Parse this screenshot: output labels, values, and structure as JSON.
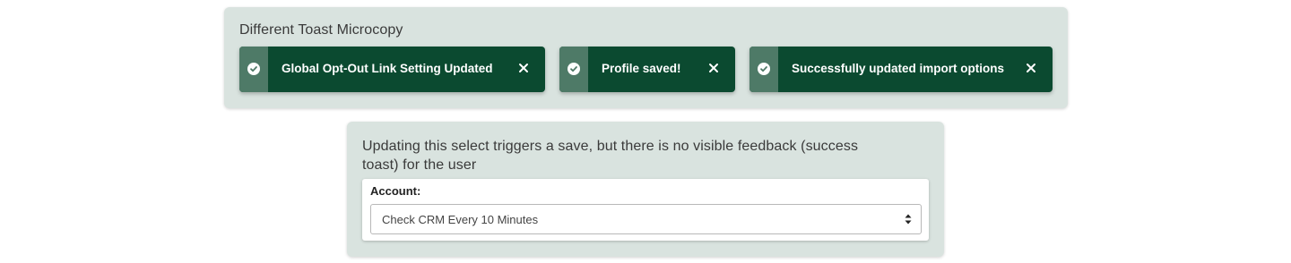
{
  "toast_panel": {
    "title": "Different Toast Microcopy",
    "toasts": [
      {
        "message": "Global Opt-Out Link Setting Updated",
        "icon": "check-circle-icon",
        "close_icon": "close-icon"
      },
      {
        "message": "Profile saved!",
        "icon": "check-circle-icon",
        "close_icon": "close-icon"
      },
      {
        "message": "Successfully updated import options",
        "icon": "check-circle-icon",
        "close_icon": "close-icon"
      }
    ]
  },
  "select_panel": {
    "title": "Updating this select triggers a save, but there is no visible feedback (success toast) for the user",
    "field_label": "Account:",
    "selected_value": "Check CRM Every 10 Minutes",
    "icon": "select-arrows-icon"
  },
  "colors": {
    "panel_bg": "#d9e3df",
    "toast_bg": "#0b4a30",
    "toast_strip": "#4e7a67",
    "toast_text": "#ffffff"
  }
}
